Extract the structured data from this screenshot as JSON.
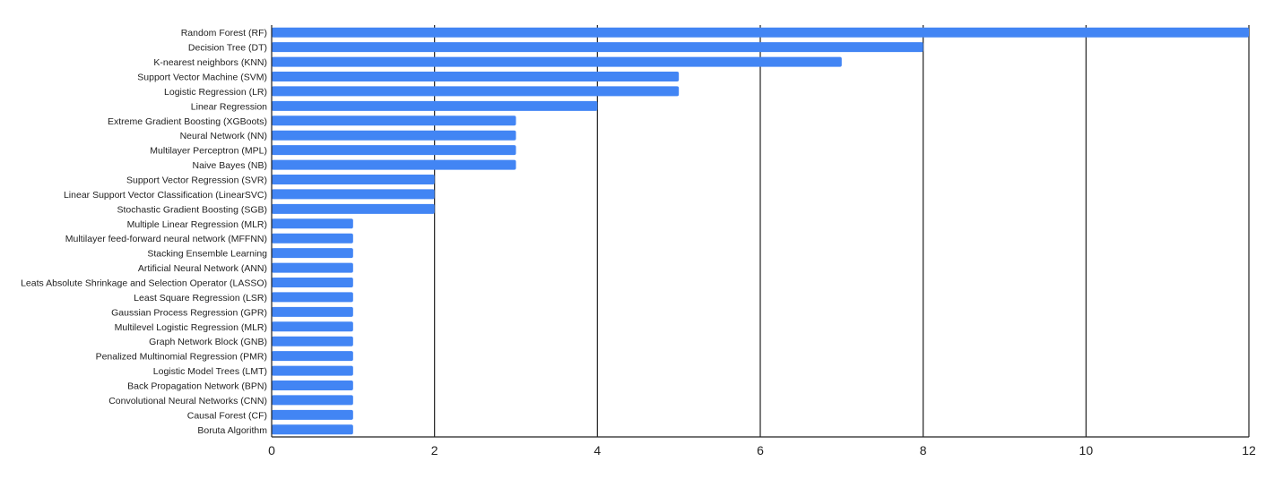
{
  "chart_data": {
    "type": "bar",
    "orientation": "horizontal",
    "title": "",
    "xlabel": "",
    "ylabel": "",
    "xlim": [
      0,
      12
    ],
    "xticks": [
      0,
      2,
      4,
      6,
      8,
      10,
      12
    ],
    "grid": true,
    "legend": "none",
    "bar_color": "#4285f4",
    "categories": [
      "Random Forest (RF)",
      "Decision Tree (DT)",
      "K-nearest neighbors (KNN)",
      "Support Vector Machine (SVM)",
      "Logistic Regression (LR)",
      "Linear Regression",
      "Extreme Gradient Boosting (XGBoots)",
      "Neural Network (NN)",
      "Multilayer Perceptron (MPL)",
      "Naive Bayes (NB)",
      "Support Vector Regression (SVR)",
      "Linear Support Vector Classification (LinearSVC)",
      "Stochastic Gradient Boosting (SGB)",
      "Multiple Linear Regression (MLR)",
      "Multilayer feed-forward neural network (MFFNN)",
      "Stacking Ensemble Learning",
      "Artificial Neural Network (ANN)",
      "Leats Absolute Shrinkage and Selection Operator (LASSO)",
      "Least Square Regression (LSR)",
      "Gaussian Process Regression (GPR)",
      "Multilevel Logistic Regression (MLR)",
      "Graph Network Block (GNB)",
      "Penalized Multinomial Regression (PMR)",
      "Logistic Model Trees (LMT)",
      "Back Propagation Network (BPN)",
      "Convolutional Neural Networks (CNN)",
      "Causal Forest (CF)",
      "Boruta Algorithm"
    ],
    "values": [
      12,
      8,
      7,
      5,
      5,
      4,
      3,
      3,
      3,
      3,
      2,
      2,
      2,
      1,
      1,
      1,
      1,
      1,
      1,
      1,
      1,
      1,
      1,
      1,
      1,
      1,
      1,
      1
    ]
  }
}
